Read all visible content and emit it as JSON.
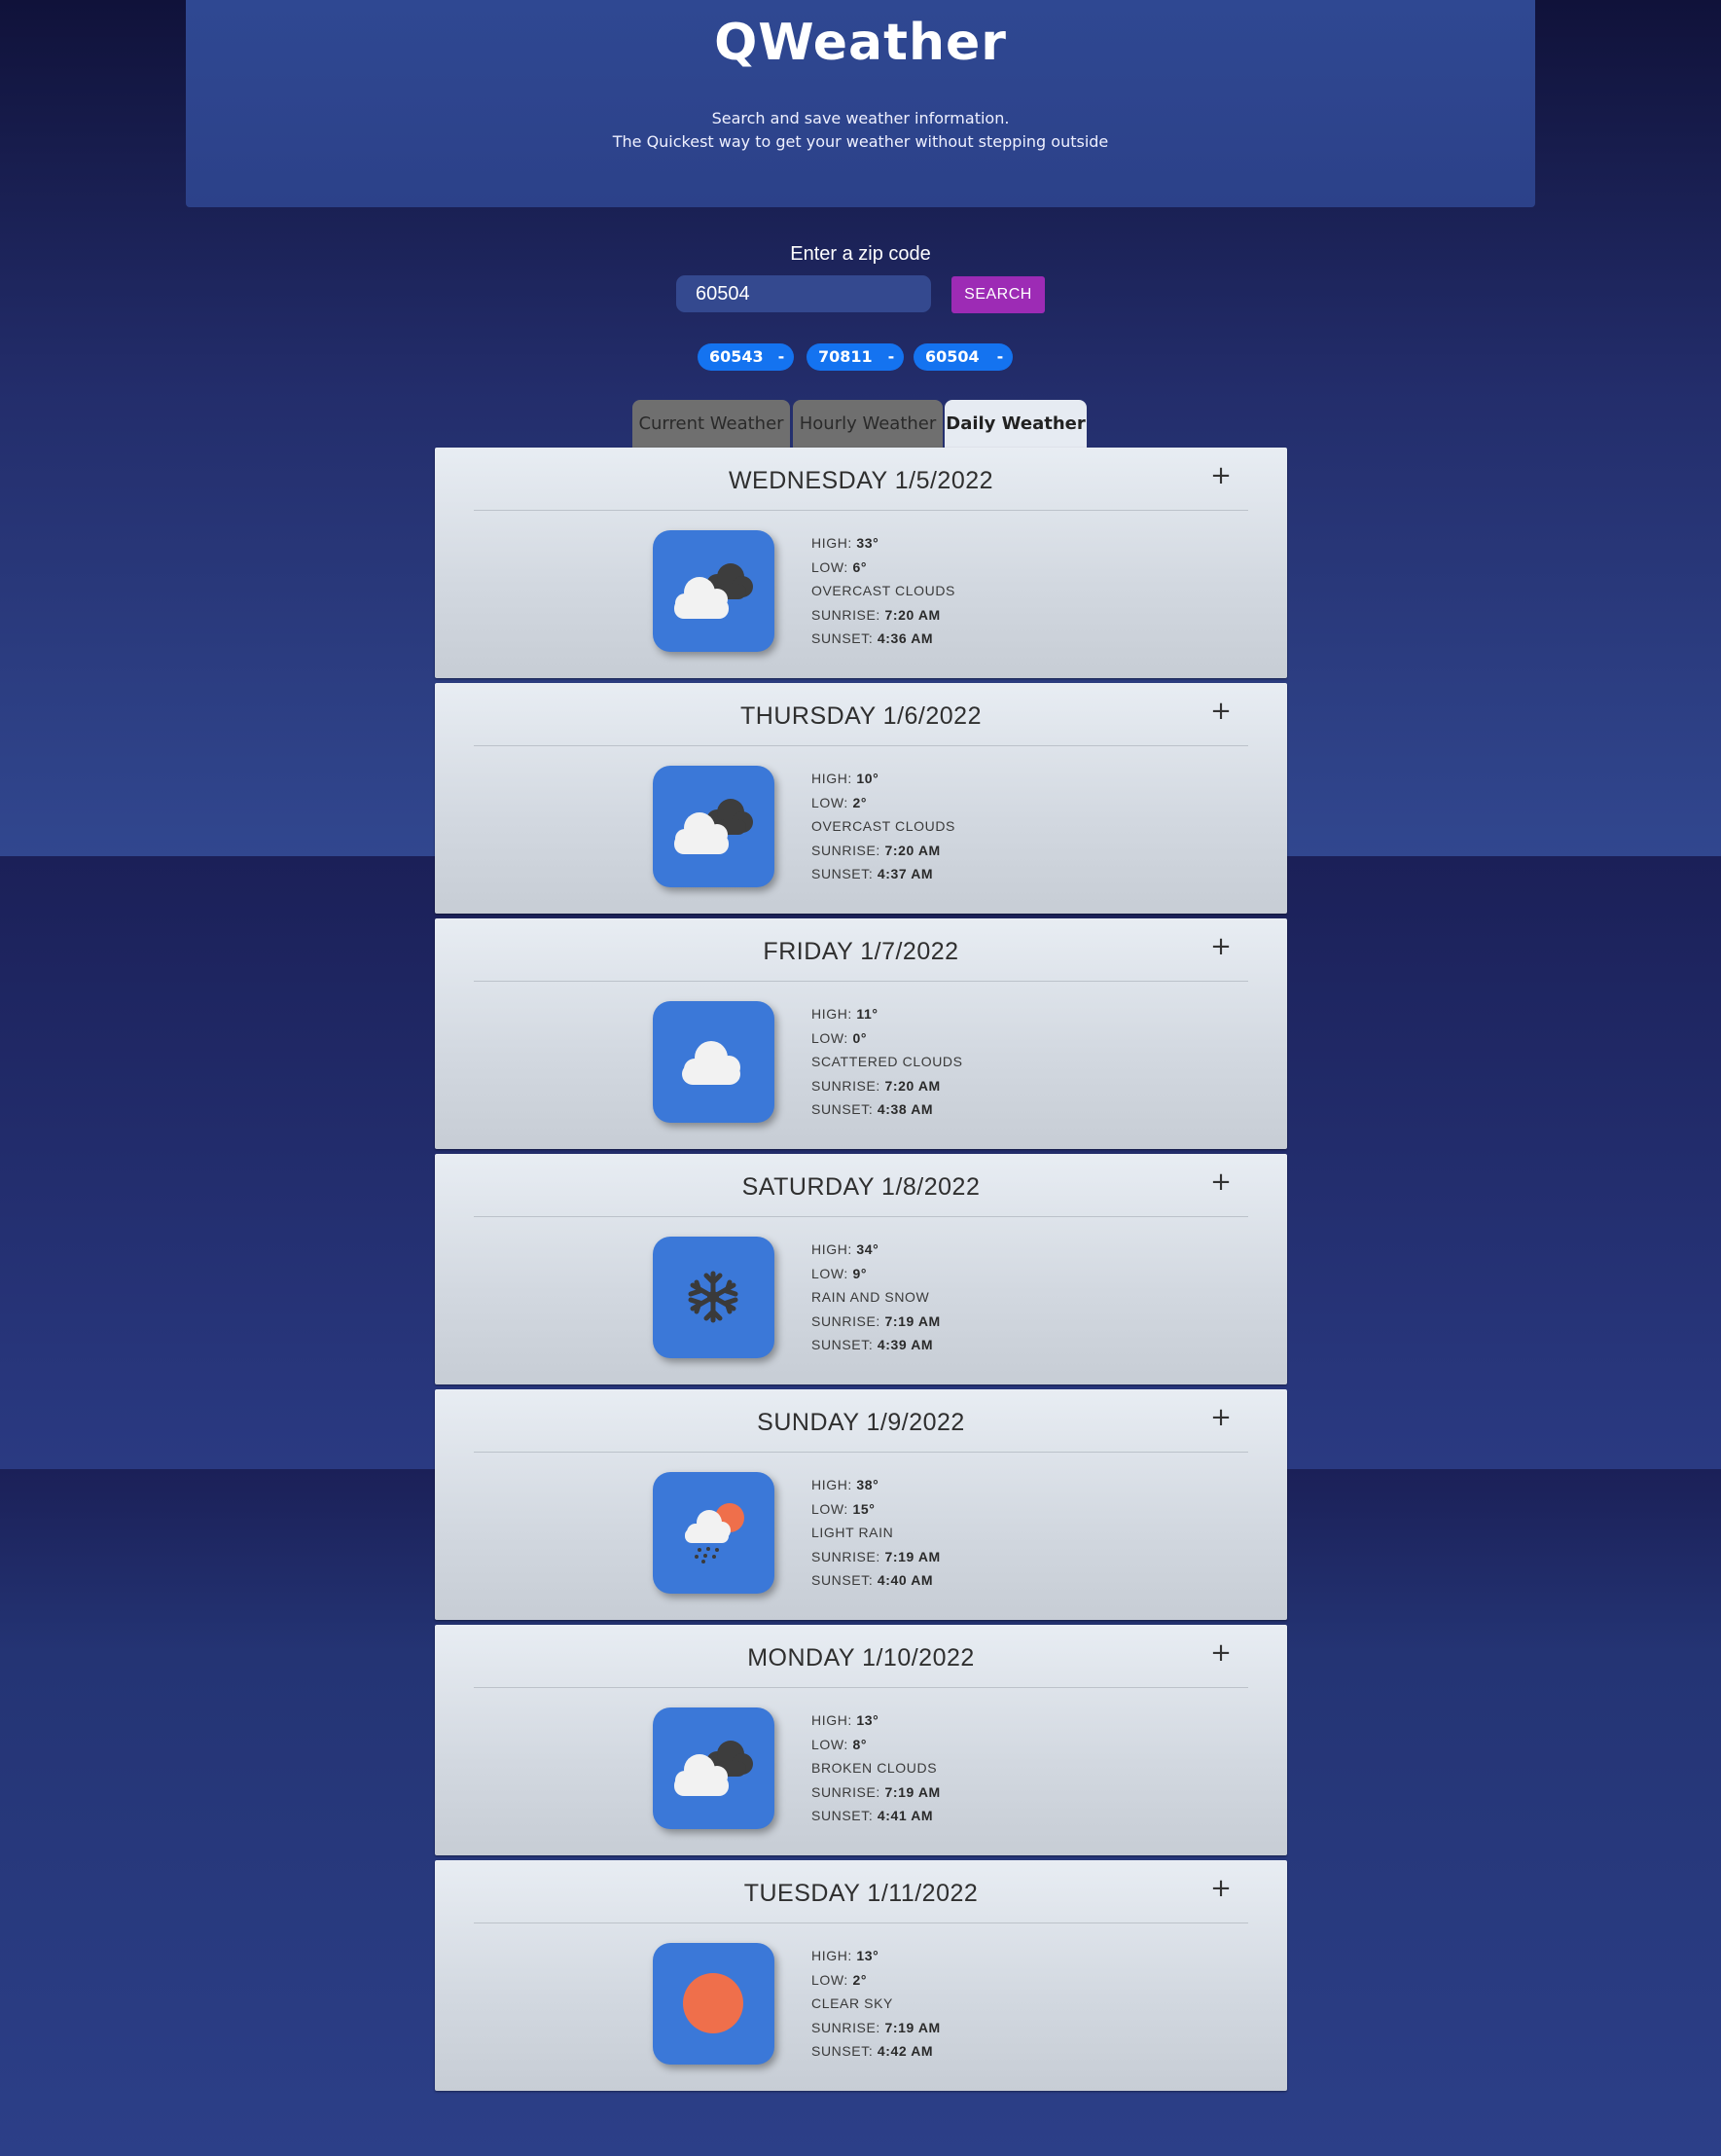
{
  "header": {
    "title": "QWeather",
    "tagline_1": "Search and save weather information.",
    "tagline_2": "The Quickest way to get your weather without stepping outside"
  },
  "search": {
    "label": "Enter a zip code",
    "value": "60504",
    "button": "SEARCH"
  },
  "saved_zips": [
    {
      "zip": "60543",
      "remove": "-"
    },
    {
      "zip": "70811",
      "remove": "-"
    },
    {
      "zip": "60504",
      "remove": "-"
    }
  ],
  "tabs": [
    {
      "label": "Current Weather",
      "active": false
    },
    {
      "label": "Hourly Weather",
      "active": false
    },
    {
      "label": "Daily Weather",
      "active": true
    }
  ],
  "labels": {
    "high": "HIGH:",
    "low": "LOW:",
    "sunrise": "SUNRISE:",
    "sunset": "SUNSET:",
    "expand": "+"
  },
  "days": [
    {
      "title": "WEDNESDAY 1/5/2022",
      "icon": "overcast-clouds-icon",
      "high": "33°",
      "low": "6°",
      "desc": "OVERCAST CLOUDS",
      "sunrise": "7:20 AM",
      "sunset": "4:36 AM"
    },
    {
      "title": "THURSDAY 1/6/2022",
      "icon": "overcast-clouds-icon",
      "high": "10°",
      "low": "2°",
      "desc": "OVERCAST CLOUDS",
      "sunrise": "7:20 AM",
      "sunset": "4:37 AM"
    },
    {
      "title": "FRIDAY 1/7/2022",
      "icon": "scattered-clouds-icon",
      "high": "11°",
      "low": "0°",
      "desc": "SCATTERED CLOUDS",
      "sunrise": "7:20 AM",
      "sunset": "4:38 AM"
    },
    {
      "title": "SATURDAY 1/8/2022",
      "icon": "snowflake-icon",
      "high": "34°",
      "low": "9°",
      "desc": "RAIN AND SNOW",
      "sunrise": "7:19 AM",
      "sunset": "4:39 AM"
    },
    {
      "title": "SUNDAY 1/9/2022",
      "icon": "light-rain-icon",
      "high": "38°",
      "low": "15°",
      "desc": "LIGHT RAIN",
      "sunrise": "7:19 AM",
      "sunset": "4:40 AM"
    },
    {
      "title": "MONDAY 1/10/2022",
      "icon": "broken-clouds-icon",
      "high": "13°",
      "low": "8°",
      "desc": "BROKEN CLOUDS",
      "sunrise": "7:19 AM",
      "sunset": "4:41 AM"
    },
    {
      "title": "TUESDAY 1/11/2022",
      "icon": "clear-sky-sun-icon",
      "high": "13°",
      "low": "2°",
      "desc": "CLEAR SKY",
      "sunrise": "7:19 AM",
      "sunset": "4:42 AM"
    }
  ],
  "colors": {
    "accent_search": "#9d2bb5",
    "saved_pill": "#1473f0",
    "icon_tile": "#3b78d8",
    "sun": "#ef6f4b"
  }
}
